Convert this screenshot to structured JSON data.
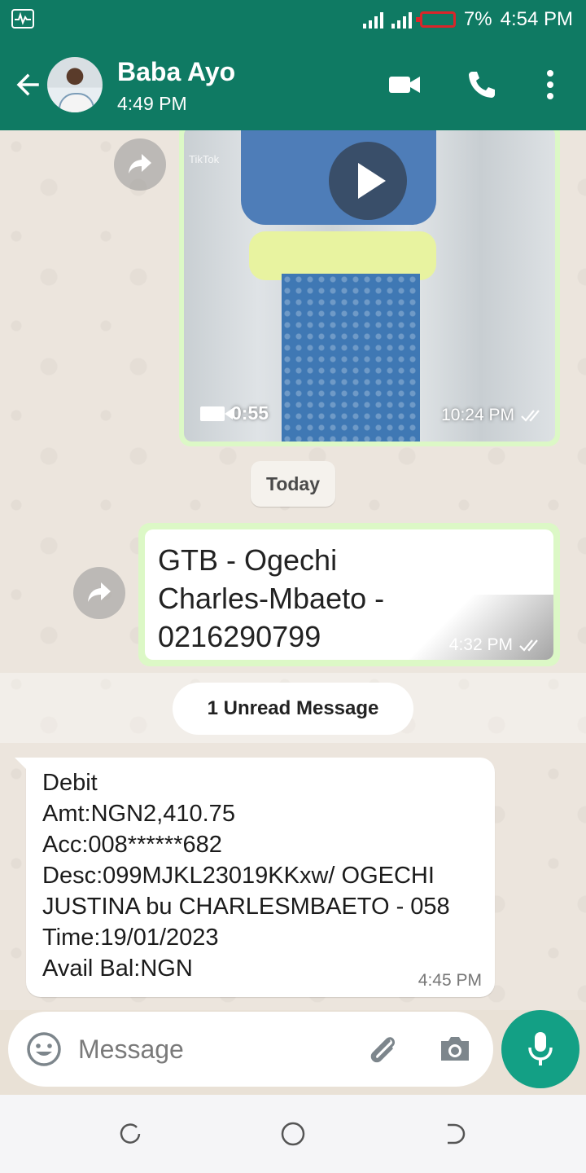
{
  "status_bar": {
    "battery_percent": "7%",
    "time": "4:54 PM",
    "battery_color": "#d9262a"
  },
  "header": {
    "contact_name": "Baba Ayo",
    "subtitle": "4:49 PM",
    "color": "#0f7a63"
  },
  "messages": {
    "video": {
      "watermark": "TikTok",
      "duration": "0:55",
      "time": "10:24 PM"
    },
    "date_divider": "Today",
    "image": {
      "text": "GTB - Ogechi\nCharles-Mbaeto -\n0216290799",
      "time": "4:32 PM"
    },
    "unread_label": "1 Unread Message",
    "incoming": {
      "text": "Debit\nAmt:NGN2,410.75\nAcc:008******682\nDesc:099MJKL23019KKxw/ OGECHI\nJUSTINA bu CHARLESMBAETO - 058\nTime:19/01/2023\nAvail Bal:NGN",
      "time": "4:45 PM"
    }
  },
  "composer": {
    "placeholder": "Message"
  },
  "colors": {
    "outgoing_bubble": "#dcf8c6",
    "mic_button": "#13a085"
  }
}
